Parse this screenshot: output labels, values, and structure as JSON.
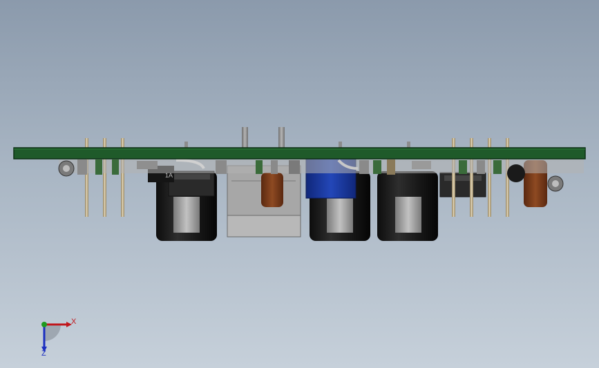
{
  "viewport": {
    "background_top": "#8b9aac",
    "background_bottom": "#c6d0da"
  },
  "model": {
    "pcb_color": "#1f5a2a",
    "capacitor_color": "#1a1a1a",
    "capacitor_sleeve": "#9a9a9a",
    "blue_component_color": "#1a3a9c",
    "terracotta_color": "#7b3a1a",
    "pin_color": "#c9b99a",
    "housing_color": "#9c9c9c",
    "component_marking": "1A"
  },
  "triad": {
    "x_label": "X",
    "z_label": "Z",
    "x_color": "#c0161c",
    "y_color": "#1f9a1f",
    "z_color": "#1c2fc0"
  }
}
